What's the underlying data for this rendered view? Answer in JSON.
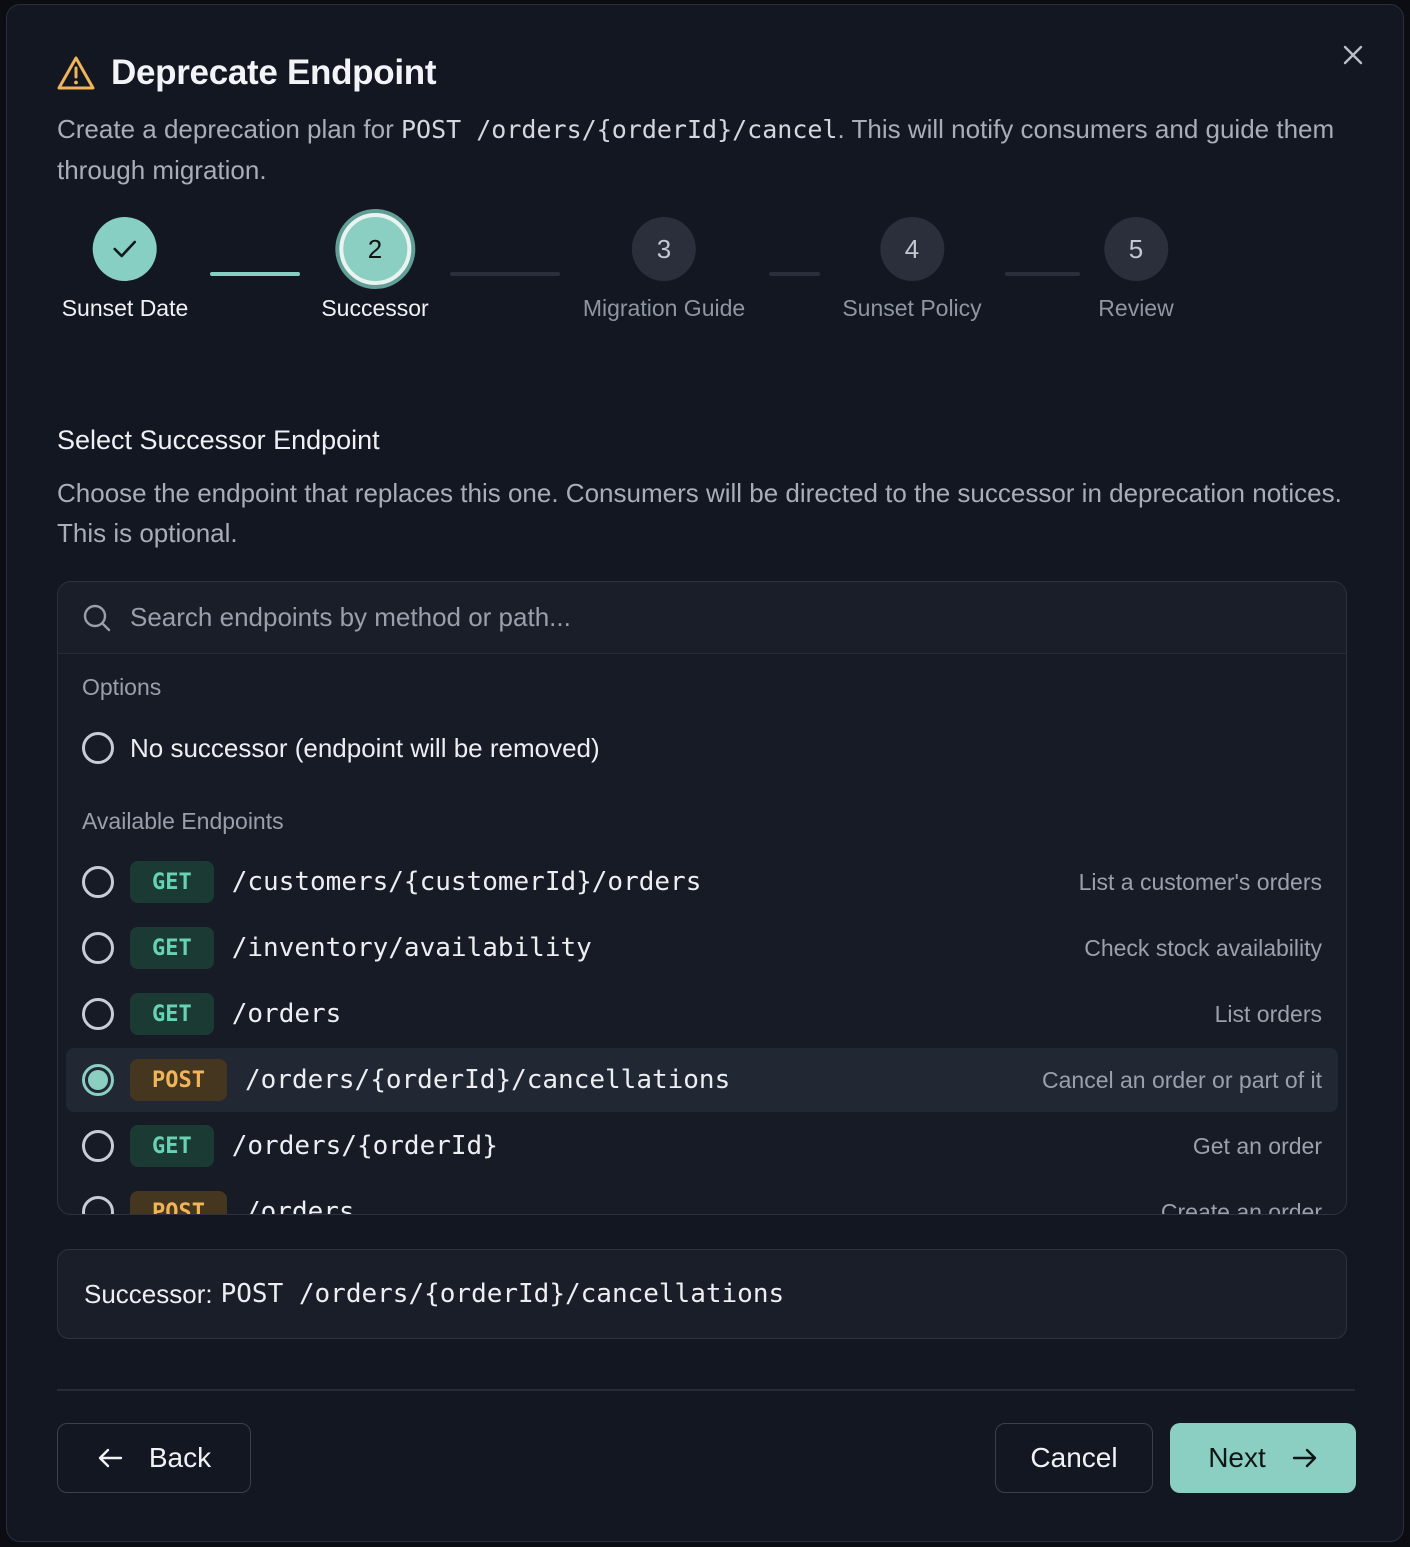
{
  "dialog": {
    "title": "Deprecate Endpoint",
    "subtitle_pre": "Create a deprecation plan for ",
    "subtitle_code": "POST /orders/{orderId}/cancel",
    "subtitle_post": ". This will notify consumers and guide them through migration."
  },
  "steps": [
    {
      "number": "1",
      "label": "Sunset Date",
      "state": "done"
    },
    {
      "number": "2",
      "label": "Successor",
      "state": "active"
    },
    {
      "number": "3",
      "label": "Migration Guide",
      "state": "pending"
    },
    {
      "number": "4",
      "label": "Sunset Policy",
      "state": "pending"
    },
    {
      "number": "5",
      "label": "Review",
      "state": "pending"
    }
  ],
  "section": {
    "title": "Select Successor Endpoint",
    "description": "Choose the endpoint that replaces this one. Consumers will be directed to the successor in deprecation notices. This is optional."
  },
  "search": {
    "placeholder": "Search endpoints by method or path..."
  },
  "options": {
    "label": "Options",
    "no_successor": "No successor (endpoint will be removed)"
  },
  "endpoints": {
    "label": "Available Endpoints",
    "items": [
      {
        "method": "GET",
        "path": "/customers/{customerId}/orders",
        "desc": "List a customer's orders",
        "selected": false
      },
      {
        "method": "GET",
        "path": "/inventory/availability",
        "desc": "Check stock availability",
        "selected": false
      },
      {
        "method": "GET",
        "path": "/orders",
        "desc": "List orders",
        "selected": false
      },
      {
        "method": "POST",
        "path": "/orders/{orderId}/cancellations",
        "desc": "Cancel an order or part of it",
        "selected": true
      },
      {
        "method": "GET",
        "path": "/orders/{orderId}",
        "desc": "Get an order",
        "selected": false
      },
      {
        "method": "POST",
        "path": "/orders",
        "desc": "Create an order",
        "selected": false
      }
    ]
  },
  "summary": {
    "label": "Successor:",
    "value": "POST /orders/{orderId}/cancellations"
  },
  "footer": {
    "back": "Back",
    "cancel": "Cancel",
    "next": "Next"
  },
  "colors": {
    "accent": "#8bcfc2",
    "get": "#67d3b5",
    "post": "#f0b45a",
    "warning": "#f0b45a"
  }
}
